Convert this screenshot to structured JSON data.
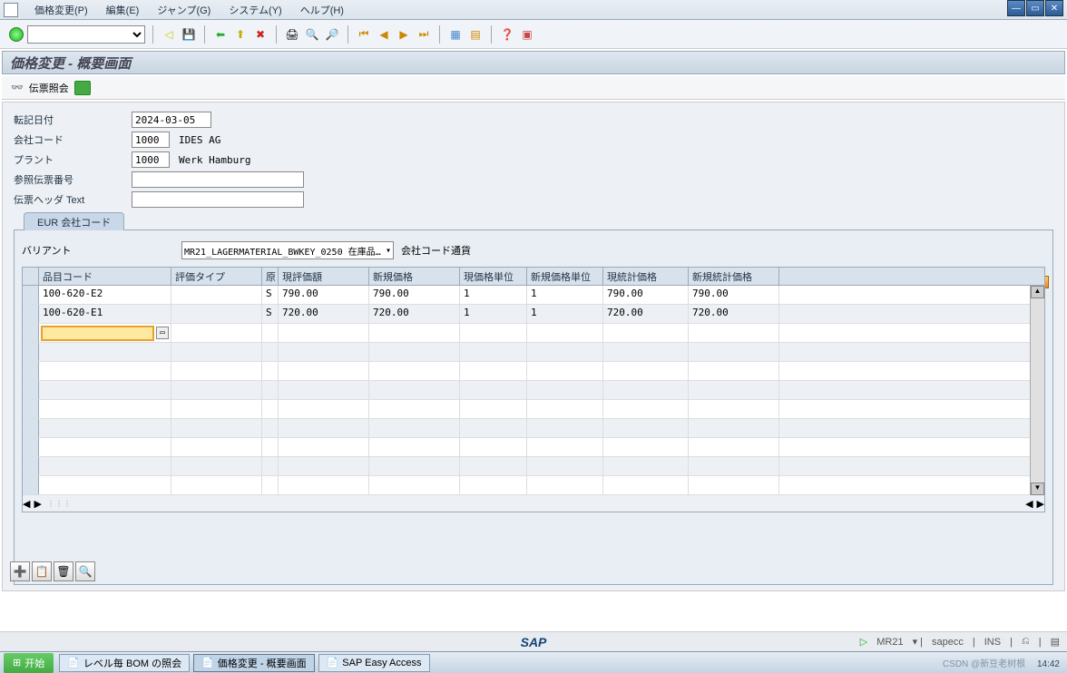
{
  "menu": {
    "items": [
      "価格変更(P)",
      "編集(E)",
      "ジャンプ(G)",
      "システム(Y)",
      "ヘルプ(H)"
    ]
  },
  "title": "価格変更 - 概要画面",
  "subToolbar": {
    "docDisplay": "伝票照会"
  },
  "form": {
    "postingDateLabel": "転記日付",
    "postingDate": "2024-03-05",
    "companyCodeLabel": "会社コード",
    "companyCode": "1000",
    "companyCodeText": "IDES AG",
    "plantLabel": "プラント",
    "plant": "1000",
    "plantText": "Werk Hamburg",
    "refDocLabel": "参照伝票番号",
    "refDoc": "",
    "docHeaderLabel": "伝票ヘッダ Text",
    "docHeader": ""
  },
  "tab": {
    "label": "EUR 会社コード"
  },
  "variant": {
    "label": "バリアント",
    "value": "MR21_LAGERMATERIAL_BWKEY_0250 在庫品…",
    "currencyLabel": "会社コード通貨"
  },
  "grid": {
    "headers": [
      "品目コード",
      "評価タイプ",
      "原",
      "現評価額",
      "新規価格",
      "現価格単位",
      "新規価格単位",
      "現統計価格",
      "新規統計価格"
    ],
    "rows": [
      {
        "material": "100-620-E2",
        "valType": "",
        "ind": "S",
        "curVal": "790.00",
        "newPrice": "790.00",
        "curUnit": "1",
        "newUnit": "1",
        "curStat": "790.00",
        "newStat": "790.00"
      },
      {
        "material": "100-620-E1",
        "valType": "",
        "ind": "S",
        "curVal": "720.00",
        "newPrice": "720.00",
        "curUnit": "1",
        "newUnit": "1",
        "curStat": "720.00",
        "newStat": "720.00"
      }
    ]
  },
  "status": {
    "sap": "SAP",
    "tcode": "MR21",
    "system": "sapecc",
    "mode": "INS"
  },
  "taskbar": {
    "start": "开始",
    "tasks": [
      "レベル毎 BOM の照会",
      "価格変更 - 概要画面",
      "SAP Easy Access"
    ],
    "time": "14:42",
    "watermark": "CSDN @新豆老树根"
  }
}
